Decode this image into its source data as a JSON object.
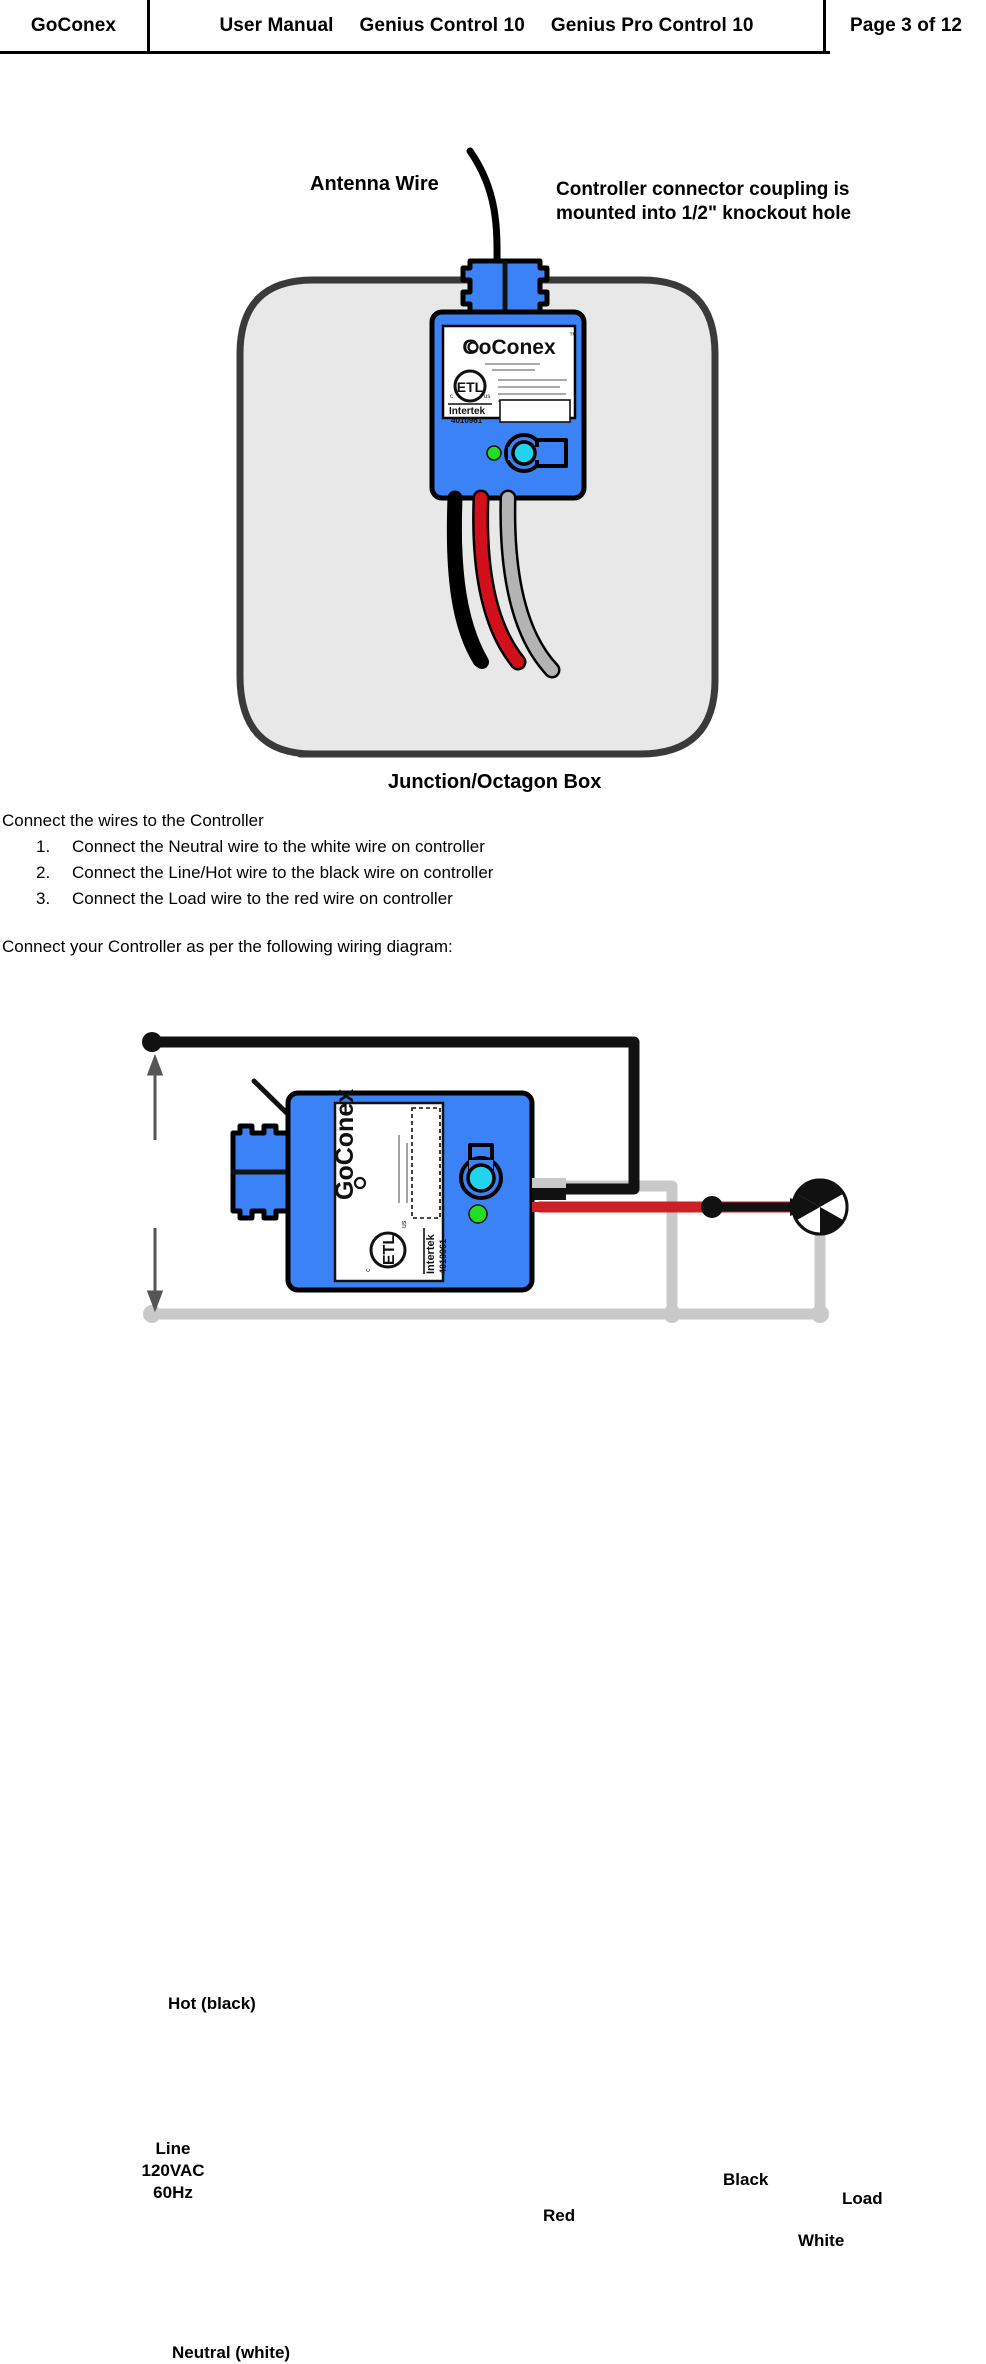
{
  "header": {
    "brand": "GoConex",
    "doc_type": "User Manual",
    "product_1": "Genius Control 10",
    "product_2": "Genius Pro Control 10",
    "page": "Page 3 of 12"
  },
  "figure_install": {
    "antenna_label": "Antenna Wire",
    "coupling_label": "Controller connector coupling is mounted into 1/2\" knockout hole",
    "box_label": "Junction/Octagon Box",
    "device": {
      "brand": "GoConex",
      "trademark": "™",
      "cert_mark": "ETL",
      "cert_c": "c",
      "cert_us": "us",
      "cert_body": "Intertek",
      "cert_number": "4010961",
      "led_color": "#22DD22",
      "button_color": "#22D3EE",
      "body_color": "#3B82F6"
    },
    "wires": [
      {
        "name": "black-wire",
        "color": "#111111"
      },
      {
        "name": "red-wire",
        "color": "#D1101B"
      },
      {
        "name": "white-wire",
        "color": "#B3B3B3"
      }
    ],
    "box_fill": "#E8E8E8",
    "box_stroke": "#3A3A3A"
  },
  "instructions": {
    "intro": "Connect the wires to the Controller",
    "steps": [
      {
        "num": "1.",
        "text": "Connect the Neutral wire to the white wire on controller"
      },
      {
        "num": "2.",
        "text": "Connect the Line/Hot wire to the black wire on controller"
      },
      {
        "num": "3.",
        "text": "Connect the Load wire to the red wire on controller"
      }
    ],
    "outro": "Connect your Controller as per the following wiring diagram:"
  },
  "figure_wiring": {
    "hot_label": "Hot (black)",
    "line_label": "Line 120VAC 60Hz",
    "neutral_label": "Neutral (white)",
    "red_label": "Red",
    "black_label": "Black",
    "load_label": "Load",
    "white_label": "White",
    "device": {
      "brand": "GoConex",
      "cert_mark": "ETL",
      "cert_body": "Intertek",
      "cert_number": "4010961"
    },
    "colors": {
      "hot": "#111111",
      "neutral": "#C9C9C9",
      "red": "#CC2027",
      "body": "#3B82F6",
      "button": "#22D3EE",
      "led": "#22DD22"
    }
  }
}
